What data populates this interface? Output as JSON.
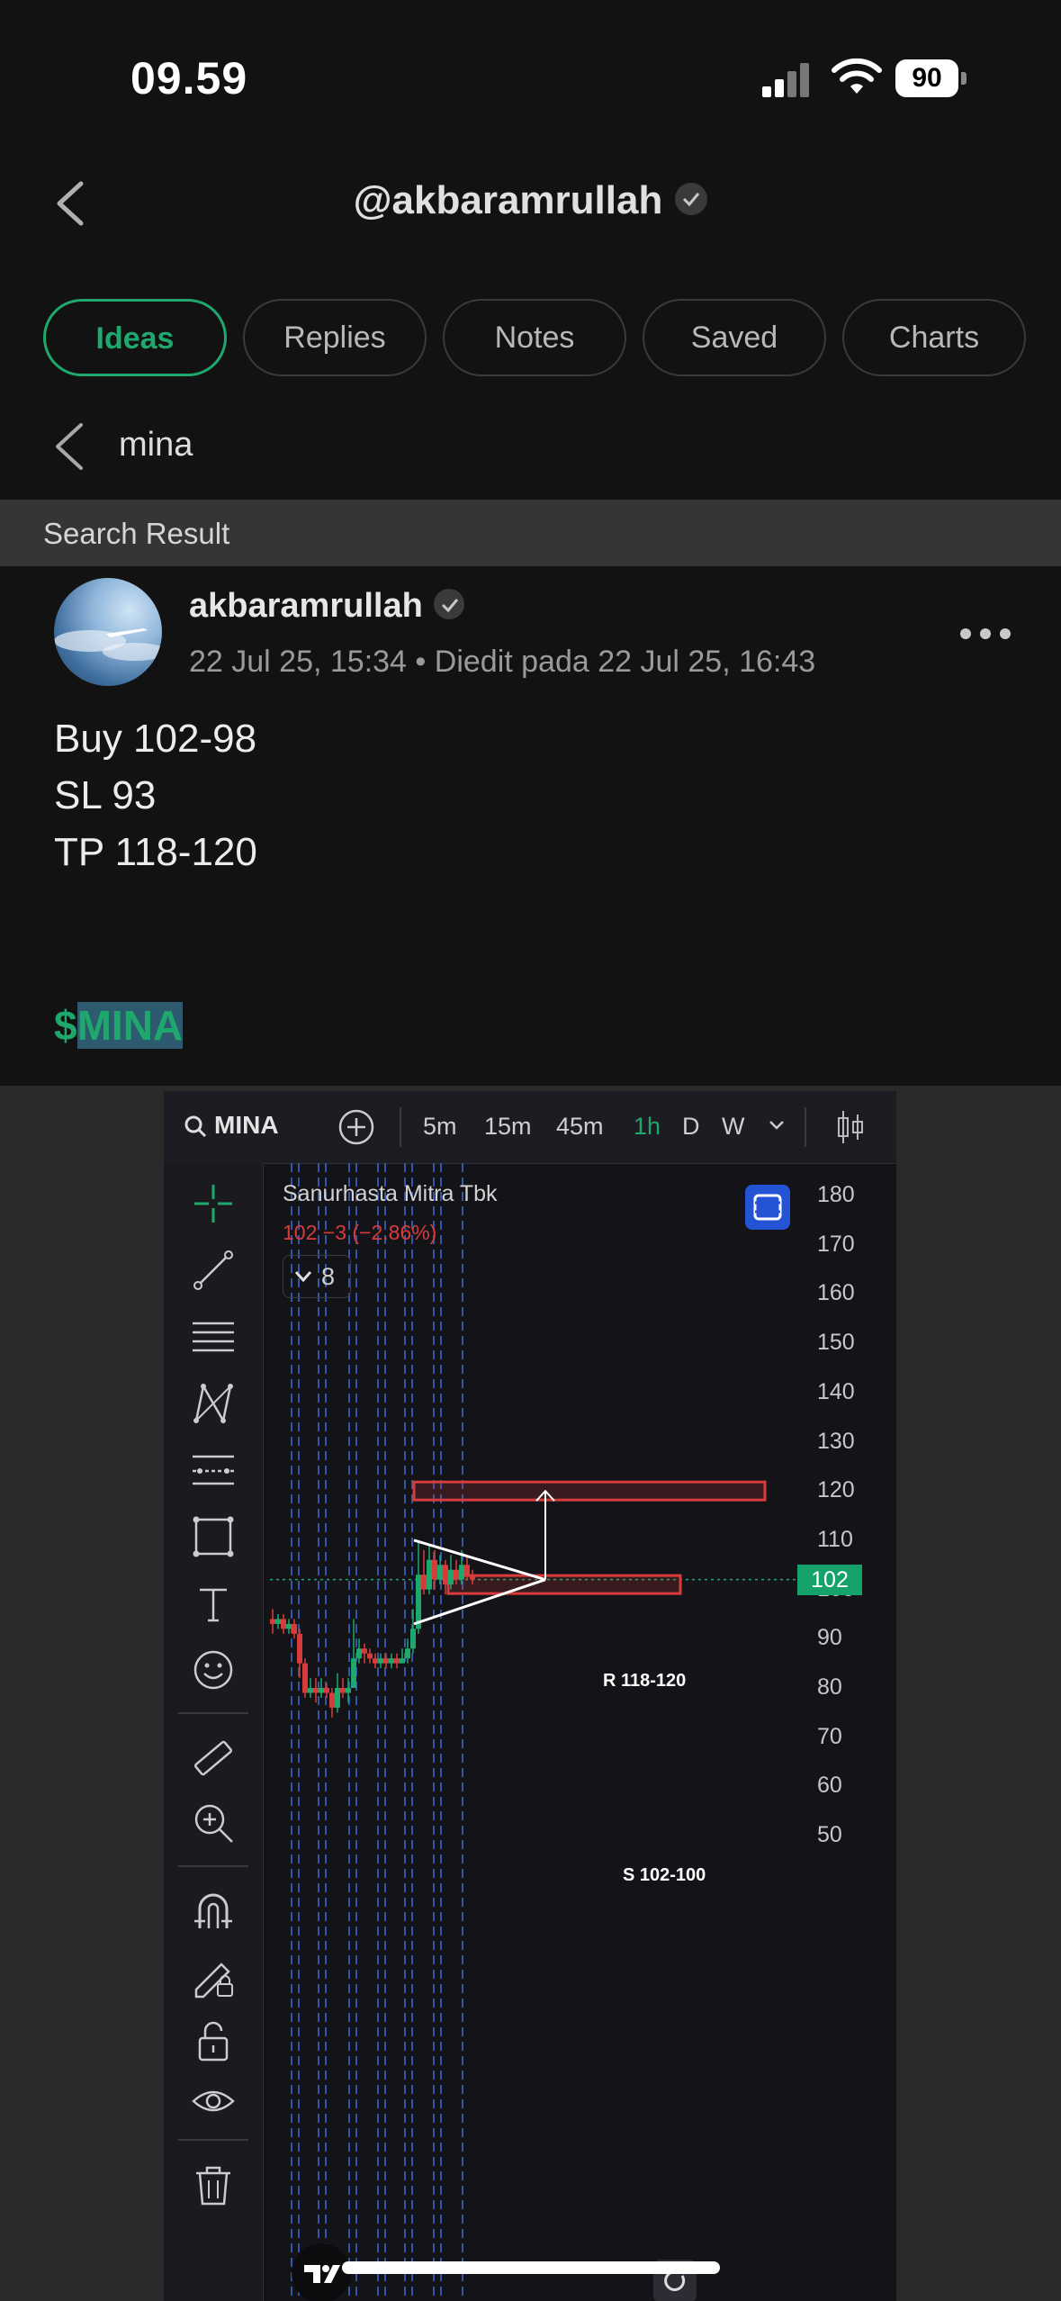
{
  "status_bar": {
    "time": "09.59",
    "battery": "90"
  },
  "header": {
    "handle": "@akbaramrullah"
  },
  "tabs": [
    {
      "label": "Ideas",
      "active": true
    },
    {
      "label": "Replies"
    },
    {
      "label": "Notes"
    },
    {
      "label": "Saved"
    },
    {
      "label": "Charts"
    }
  ],
  "search": {
    "query": "mina",
    "result_label": "Search Result"
  },
  "post": {
    "author": "akbaramrullah",
    "date": "22 Jul 25, 15:34 • Diedit pada 22 Jul 25, 16:43",
    "lines": [
      "Buy 102-98",
      "SL 93",
      "TP 118-120"
    ],
    "ticker_prefix": "$",
    "ticker": "MINA"
  },
  "chart": {
    "symbol": "MINA",
    "intervals": [
      "5m",
      "15m",
      "45m",
      "1h",
      "D",
      "W"
    ],
    "active_interval": "1h",
    "company": "Sanurhasta Mitra Tbk",
    "change": "102  −3 (−2.86%)",
    "indicator_count": "8",
    "y_ticks": [
      "180",
      "170",
      "160",
      "150",
      "140",
      "130",
      "120",
      "110",
      "100",
      "90",
      "80",
      "70",
      "60",
      "50"
    ],
    "last_price": "102",
    "resistance_label": "R 118-120",
    "support_label": "S 102-100",
    "colors": {
      "up": "#1fa86e",
      "down": "#d63c3c",
      "zone": "#d63c3c",
      "vline": "#3b6fd6"
    }
  }
}
